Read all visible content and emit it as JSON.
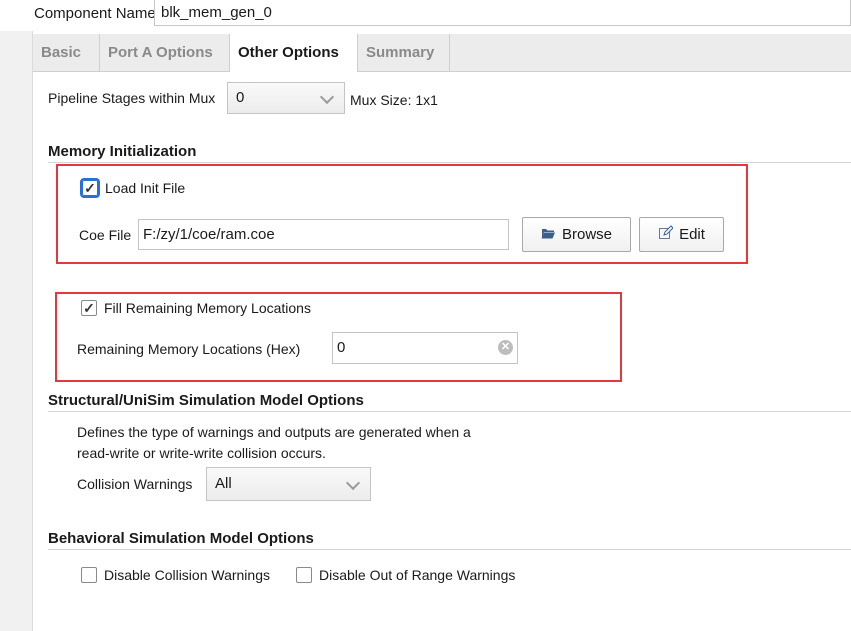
{
  "header": {
    "component_name_label": "Component Name",
    "component_name_value": "blk_mem_gen_0"
  },
  "tabs": [
    {
      "label": "Basic",
      "active": false
    },
    {
      "label": "Port A Options",
      "active": false
    },
    {
      "label": "Other Options",
      "active": true
    },
    {
      "label": "Summary",
      "active": false
    }
  ],
  "pipeline": {
    "label": "Pipeline Stages within Mux",
    "value": "0",
    "mux_size": "Mux Size: 1x1"
  },
  "memory_init": {
    "title": "Memory Initialization",
    "load_init_file_label": "Load Init File",
    "load_init_file_checked": true,
    "coe_file_label": "Coe File",
    "coe_file_value": "F:/zy/1/coe/ram.coe",
    "browse_label": "Browse",
    "edit_label": "Edit"
  },
  "fill": {
    "fill_label": "Fill Remaining Memory Locations",
    "fill_checked": true,
    "remaining_label": "Remaining Memory Locations (Hex)",
    "remaining_value": "0"
  },
  "structural": {
    "title": "Structural/UniSim Simulation Model Options",
    "desc_line1": "Defines the type of warnings and outputs are generated when a",
    "desc_line2": "read-write or write-write collision occurs.",
    "collision_label": "Collision Warnings",
    "collision_value": "All"
  },
  "behavioral": {
    "title": "Behavioral Simulation Model Options",
    "disable_collision_label": "Disable Collision Warnings",
    "disable_collision_checked": false,
    "disable_range_label": "Disable Out of Range Warnings",
    "disable_range_checked": false
  },
  "icons": {
    "folder": "folder-icon",
    "edit": "pencil-icon",
    "clear": "clear-icon",
    "chevron": "chevron-down-icon"
  },
  "colors": {
    "highlight_box": "#e2393f",
    "focus": "#2a6fd6"
  }
}
